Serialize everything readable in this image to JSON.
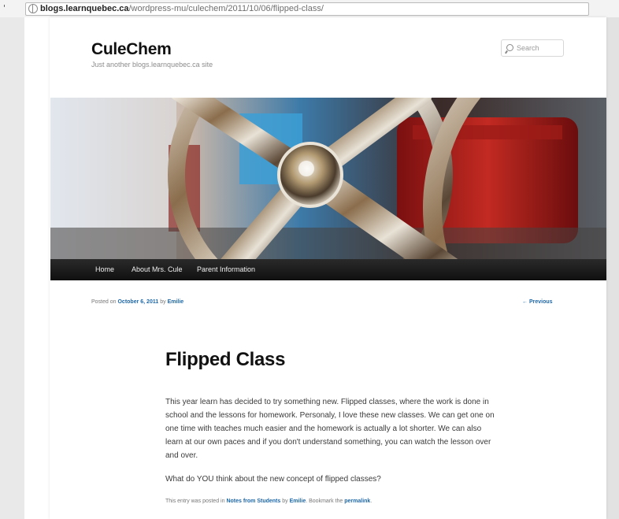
{
  "browser": {
    "url_host": "blogs.learnquebec.ca",
    "url_path": "/wordpress-mu/culechem/2011/10/06/flipped-class/",
    "tick": "'"
  },
  "site": {
    "title": "CuleChem",
    "description": "Just another blogs.learnquebec.ca site",
    "search_placeholder": "Search"
  },
  "nav": {
    "items": [
      "Home",
      "About Mrs. Cule",
      "Parent Information"
    ]
  },
  "post": {
    "posted_on_label": "Posted on",
    "date": "October 6, 2011",
    "by_label": "by",
    "author": "Emilie",
    "prev_link": "← Previous",
    "title": "Flipped Class",
    "body": "This year learn has decided to try something new. Flipped classes, where the work is done in school and the lessons for homework. Personaly, I love these new classes. We can get one on one time with teaches much easier and the homework is actually a lot shorter. We can also learn at our own paces and if you don't understand something, you can watch the lesson over and over.",
    "question": "What do YOU think about the new concept of flipped classes?",
    "footer": {
      "posted_in_label": "This entry was posted in",
      "category": "Notes from Students",
      "by_label": "by",
      "author": "Emilie",
      "bookmark_label": ". Bookmark the",
      "permalink": "permalink",
      "end": "."
    }
  },
  "colors": {
    "link": "#1e68a8",
    "nav_bg": "#1a1a1a"
  }
}
